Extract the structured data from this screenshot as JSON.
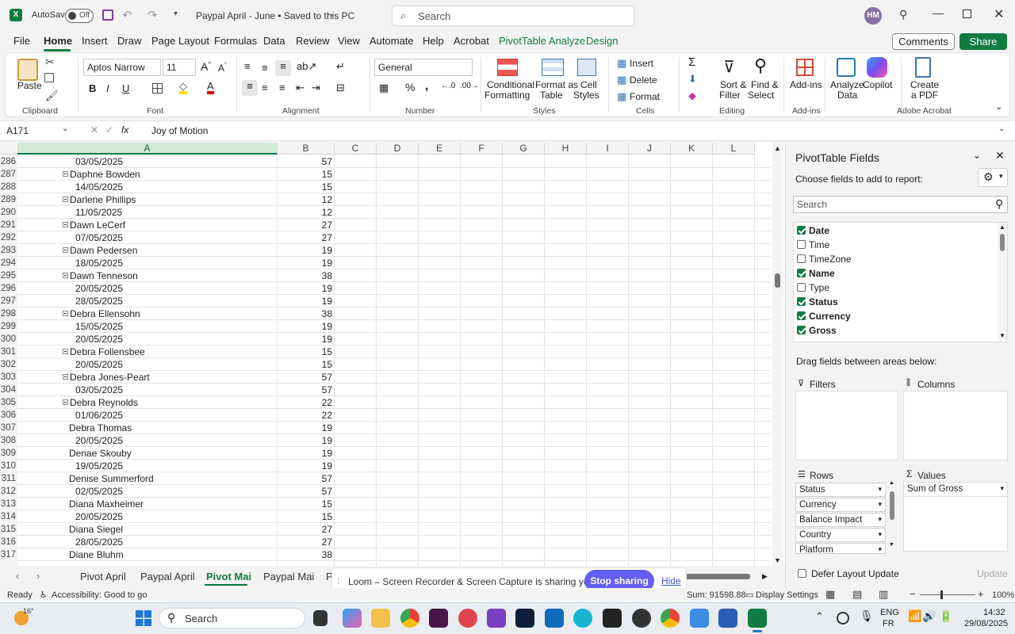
{
  "titlebar": {
    "autosave_label": "AutoSave",
    "autosave_state": "Off",
    "doc_title": "Paypal April - June • Saved to this PC",
    "search_placeholder": "Search",
    "avatar_initials": "HM"
  },
  "menu": [
    "File",
    "Home",
    "Insert",
    "Draw",
    "Page Layout",
    "Formulas",
    "Data",
    "Review",
    "View",
    "Automate",
    "Help",
    "Acrobat",
    "PivotTable Analyze",
    "Design"
  ],
  "menu_active": "Home",
  "buttons": {
    "comments": "Comments",
    "share": "Share"
  },
  "ribbon": {
    "paste": "Paste",
    "font_name": "Aptos Narrow",
    "font_size": "11",
    "number_format": "General",
    "conditional": [
      "Conditional",
      "Formatting"
    ],
    "format_table": [
      "Format as",
      "Table"
    ],
    "cell_styles": [
      "Cell",
      "Styles"
    ],
    "insert": "Insert",
    "delete": "Delete",
    "format": "Format",
    "sort_filter": [
      "Sort &",
      "Filter"
    ],
    "find_select": [
      "Find &",
      "Select"
    ],
    "addins": "Add-ins",
    "analyze": [
      "Analyze",
      "Data"
    ],
    "copilot": "Copilot",
    "create_pdf": [
      "Create",
      "a PDF"
    ],
    "groups": [
      "Clipboard",
      "Font",
      "Alignment",
      "Number",
      "Styles",
      "Cells",
      "Editing",
      "Add-ins",
      "Adobe Acrobat"
    ]
  },
  "formula_bar": {
    "name_box": "A171",
    "fx": "fx",
    "value": "Joy of Motion"
  },
  "columns": [
    "A",
    "B",
    "C",
    "D",
    "E",
    "F",
    "G",
    "H",
    "I",
    "J",
    "K",
    "L"
  ],
  "rows": [
    {
      "n": "286",
      "a": "03/05/2025",
      "b": "57",
      "type": "date"
    },
    {
      "n": "287",
      "a": "Daphne Bowden",
      "b": "15",
      "type": "name"
    },
    {
      "n": "288",
      "a": "14/05/2025",
      "b": "15",
      "type": "date"
    },
    {
      "n": "289",
      "a": "Darlene Phillips",
      "b": "12",
      "type": "name"
    },
    {
      "n": "290",
      "a": "11/05/2025",
      "b": "12",
      "type": "date"
    },
    {
      "n": "291",
      "a": "Dawn LeCerf",
      "b": "27",
      "type": "name"
    },
    {
      "n": "292",
      "a": "07/05/2025",
      "b": "27",
      "type": "date"
    },
    {
      "n": "293",
      "a": "Dawn Pedersen",
      "b": "19",
      "type": "name"
    },
    {
      "n": "294",
      "a": "18/05/2025",
      "b": "19",
      "type": "date"
    },
    {
      "n": "295",
      "a": "Dawn Tenneson",
      "b": "38",
      "type": "name"
    },
    {
      "n": "296",
      "a": "20/05/2025",
      "b": "19",
      "type": "date"
    },
    {
      "n": "297",
      "a": "28/05/2025",
      "b": "19",
      "type": "date"
    },
    {
      "n": "298",
      "a": "Debra Ellensohn",
      "b": "38",
      "type": "name"
    },
    {
      "n": "299",
      "a": "15/05/2025",
      "b": "19",
      "type": "date"
    },
    {
      "n": "300",
      "a": "20/05/2025",
      "b": "19",
      "type": "date"
    },
    {
      "n": "301",
      "a": "Debra Follensbee",
      "b": "15",
      "type": "name"
    },
    {
      "n": "302",
      "a": "20/05/2025",
      "b": "15",
      "type": "date"
    },
    {
      "n": "303",
      "a": "Debra Jones-Peart",
      "b": "57",
      "type": "name"
    },
    {
      "n": "304",
      "a": "03/05/2025",
      "b": "57",
      "type": "date"
    },
    {
      "n": "305",
      "a": "Debra Reynolds",
      "b": "22",
      "type": "name"
    },
    {
      "n": "306",
      "a": "01/06/2025",
      "b": "22",
      "type": "date"
    },
    {
      "n": "307",
      "a": "Debra Thomas",
      "b": "19",
      "type": "name2"
    },
    {
      "n": "308",
      "a": "20/05/2025",
      "b": "19",
      "type": "date"
    },
    {
      "n": "309",
      "a": "Denae Skouby",
      "b": "19",
      "type": "name2"
    },
    {
      "n": "310",
      "a": "19/05/2025",
      "b": "19",
      "type": "date"
    },
    {
      "n": "311",
      "a": "Denise Summerford",
      "b": "57",
      "type": "name2"
    },
    {
      "n": "312",
      "a": "02/05/2025",
      "b": "57",
      "type": "date"
    },
    {
      "n": "313",
      "a": "Diana Maxheimer",
      "b": "15",
      "type": "name2"
    },
    {
      "n": "314",
      "a": "20/05/2025",
      "b": "15",
      "type": "date"
    },
    {
      "n": "315",
      "a": "Diana Siegel",
      "b": "27",
      "type": "name2"
    },
    {
      "n": "316",
      "a": "28/05/2025",
      "b": "27",
      "type": "date"
    },
    {
      "n": "317",
      "a": "Diane Bluhm",
      "b": "38",
      "type": "name2"
    }
  ],
  "sheet_tabs": [
    "Pivot April",
    "Paypal April",
    "Pivot Mai",
    "Paypal Mai",
    "P"
  ],
  "sheet_active": "Pivot Mai",
  "loom": {
    "message": "Loom – Screen Recorder & Screen Capture is sharing your screen.",
    "stop": "Stop sharing",
    "hide": "Hide"
  },
  "pivot": {
    "title": "PivotTable Fields",
    "subtitle": "Choose fields to add to report:",
    "search_placeholder": "Search",
    "fields": [
      {
        "label": "Date",
        "checked": true
      },
      {
        "label": "Time",
        "checked": false
      },
      {
        "label": "TimeZone",
        "checked": false
      },
      {
        "label": "Name",
        "checked": true
      },
      {
        "label": "Type",
        "checked": false
      },
      {
        "label": "Status",
        "checked": true
      },
      {
        "label": "Currency",
        "checked": true
      },
      {
        "label": "Gross",
        "checked": true
      }
    ],
    "drag_text": "Drag fields between areas below:",
    "filters": "Filters",
    "columns": "Columns",
    "rows": "Rows",
    "values": "Values",
    "row_items": [
      "Status",
      "Currency",
      "Balance Impact",
      "Country",
      "Platform"
    ],
    "value_items": [
      "Sum of Gross"
    ],
    "defer": "Defer Layout Update",
    "update": "Update"
  },
  "status": {
    "ready": "Ready",
    "accessibility": "Accessibility: Good to go",
    "sum": "Sum: 91598.88",
    "display": "Display Settings",
    "zoom": "100%"
  },
  "taskbar": {
    "temp": "16°",
    "search": "Search",
    "lang1": "ENG",
    "lang2": "FR",
    "time": "14:32",
    "date": "29/08/2025"
  }
}
